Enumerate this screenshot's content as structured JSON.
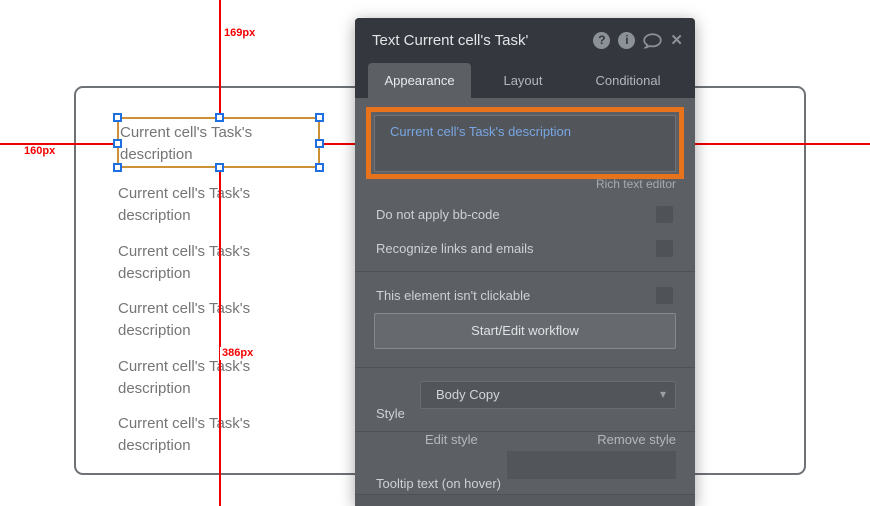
{
  "panel": {
    "title": "Text Current cell's Task'",
    "tabs": [
      {
        "label": "Appearance",
        "active": true
      },
      {
        "label": "Layout",
        "active": false
      },
      {
        "label": "Conditional",
        "active": false
      }
    ],
    "content": {
      "value": "Current cell's Task's description",
      "editor_link": "Rich text editor"
    },
    "options": [
      {
        "label": "Do not apply bb-code",
        "checked": false
      },
      {
        "label": "Recognize links and emails",
        "checked": false
      },
      {
        "label": "This element isn't clickable",
        "checked": false
      }
    ],
    "workflow_button": "Start/Edit workflow",
    "style": {
      "label": "Style",
      "value": "Body Copy",
      "edit": "Edit style",
      "remove": "Remove style"
    },
    "tooltip": {
      "label": "Tooltip text (on hover)",
      "value": ""
    },
    "header_icons": [
      "help-icon",
      "info-icon",
      "comment-icon",
      "close-icon"
    ]
  },
  "canvas": {
    "text_items": [
      {
        "text": "Current cell's Task's description"
      },
      {
        "text": "Current cell's Task's description"
      },
      {
        "text": "Current cell's Task's description"
      },
      {
        "text": "Current cell's Task's description"
      },
      {
        "text": "Current cell's Task's description"
      },
      {
        "text": "Current cell's Task's description"
      }
    ],
    "measurements": [
      {
        "text": "169px"
      },
      {
        "text": "160px"
      },
      {
        "text": "386px"
      }
    ]
  },
  "colors": {
    "accent_orange": "#e9731d",
    "guide_red": "#ee0000",
    "selection_border": "#cc9136",
    "handle_blue": "#1f6fe0",
    "value_blue": "#79a6e2",
    "panel_dark": "#34383e",
    "panel_body": "#5c6065"
  }
}
